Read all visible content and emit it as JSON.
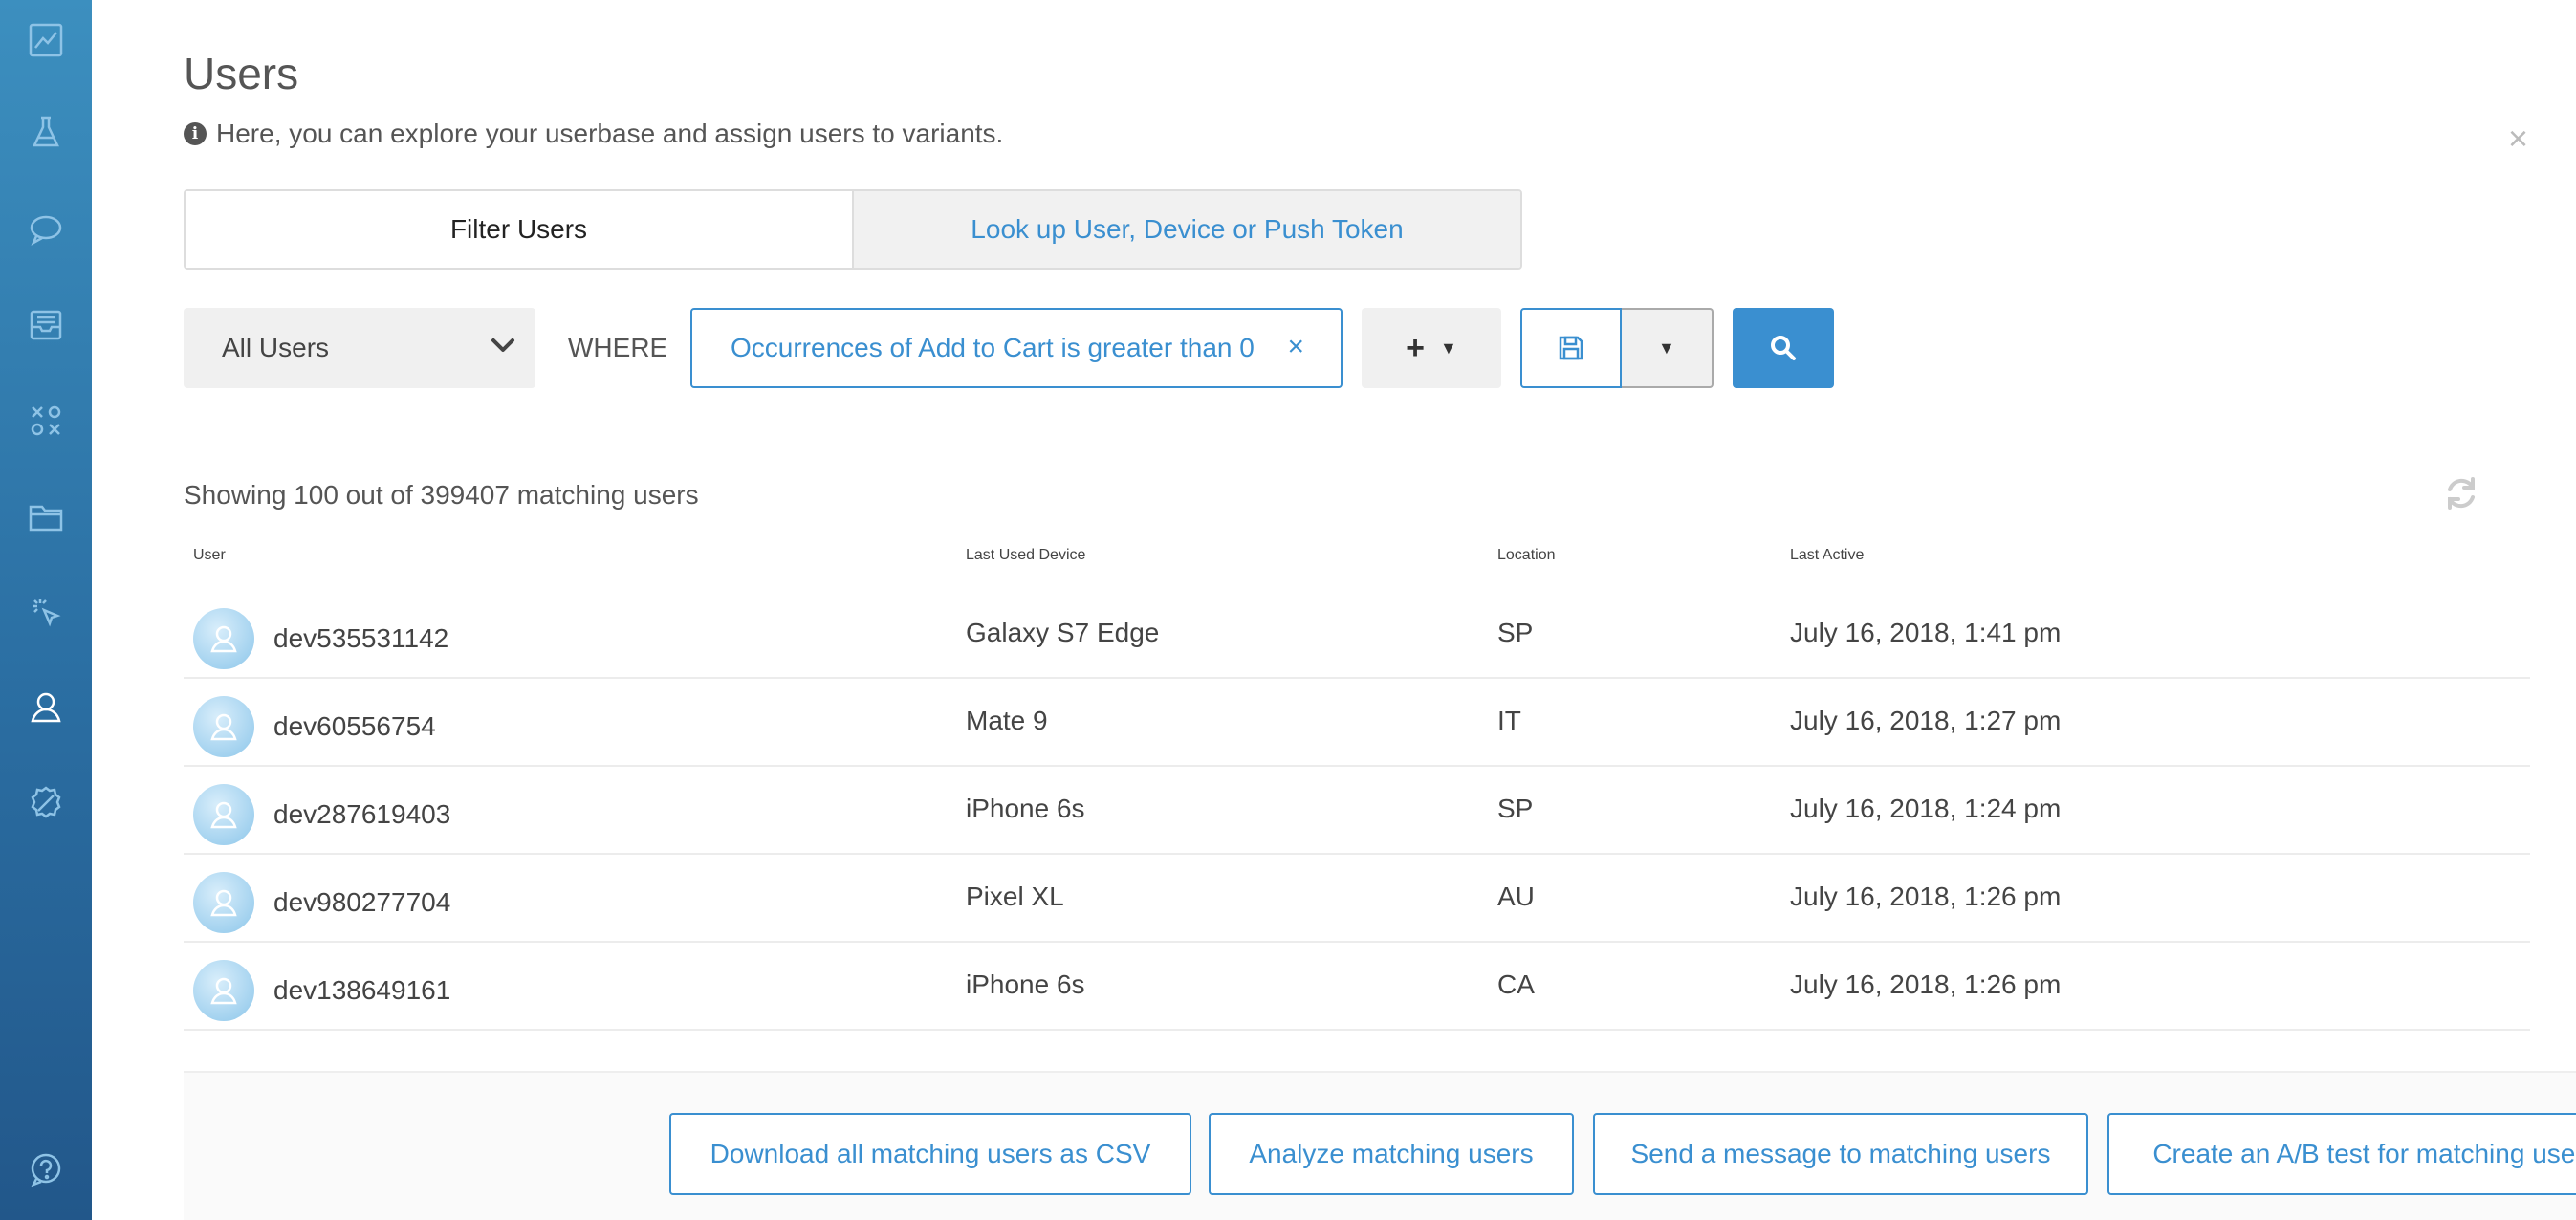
{
  "sidebar": {
    "items": [
      {
        "icon": "line-chart-icon"
      },
      {
        "icon": "beaker-icon"
      },
      {
        "icon": "chat-bubble-icon"
      },
      {
        "icon": "inbox-icon"
      },
      {
        "icon": "ab-test-icon"
      },
      {
        "icon": "folder-icon"
      },
      {
        "icon": "cursor-click-icon"
      },
      {
        "icon": "users-icon",
        "active": true
      },
      {
        "icon": "bug-icon"
      },
      {
        "icon": "help-icon"
      }
    ]
  },
  "header": {
    "title": "Users",
    "subtitle": "Here, you can explore your userbase and assign users to variants.",
    "close": "×"
  },
  "tabs": [
    {
      "label": "Filter Users",
      "active": true
    },
    {
      "label": "Look up User, Device or Push Token",
      "active": false
    }
  ],
  "filter": {
    "segment": "All Users",
    "where_label": "WHERE",
    "condition": "Occurrences of Add to Cart is greater than 0",
    "condition_remove": "×",
    "add_label": "+"
  },
  "results": {
    "summary": "Showing 100 out of 399407 matching users"
  },
  "table": {
    "columns": [
      "User",
      "Last Used Device",
      "Location",
      "Last Active"
    ],
    "rows": [
      {
        "user": "dev535531142",
        "device": "Galaxy S7 Edge",
        "location": "SP",
        "last_active": "July 16, 2018, 1:41 pm"
      },
      {
        "user": "dev60556754",
        "device": "Mate 9",
        "location": "IT",
        "last_active": "July 16, 2018, 1:27 pm"
      },
      {
        "user": "dev287619403",
        "device": "iPhone 6s",
        "location": "SP",
        "last_active": "July 16, 2018, 1:24 pm"
      },
      {
        "user": "dev980277704",
        "device": "Pixel XL",
        "location": "AU",
        "last_active": "July 16, 2018, 1:26 pm"
      },
      {
        "user": "dev138649161",
        "device": "iPhone 6s",
        "location": "CA",
        "last_active": "July 16, 2018, 1:26 pm"
      }
    ]
  },
  "actions": {
    "download": "Download all matching users as CSV",
    "analyze": "Analyze matching users",
    "message": "Send a message to matching users",
    "ab_test": "Create an A/B test for matching users"
  },
  "colors": {
    "accent": "#3a8fd0",
    "sidebar": "#2b6fa3"
  }
}
